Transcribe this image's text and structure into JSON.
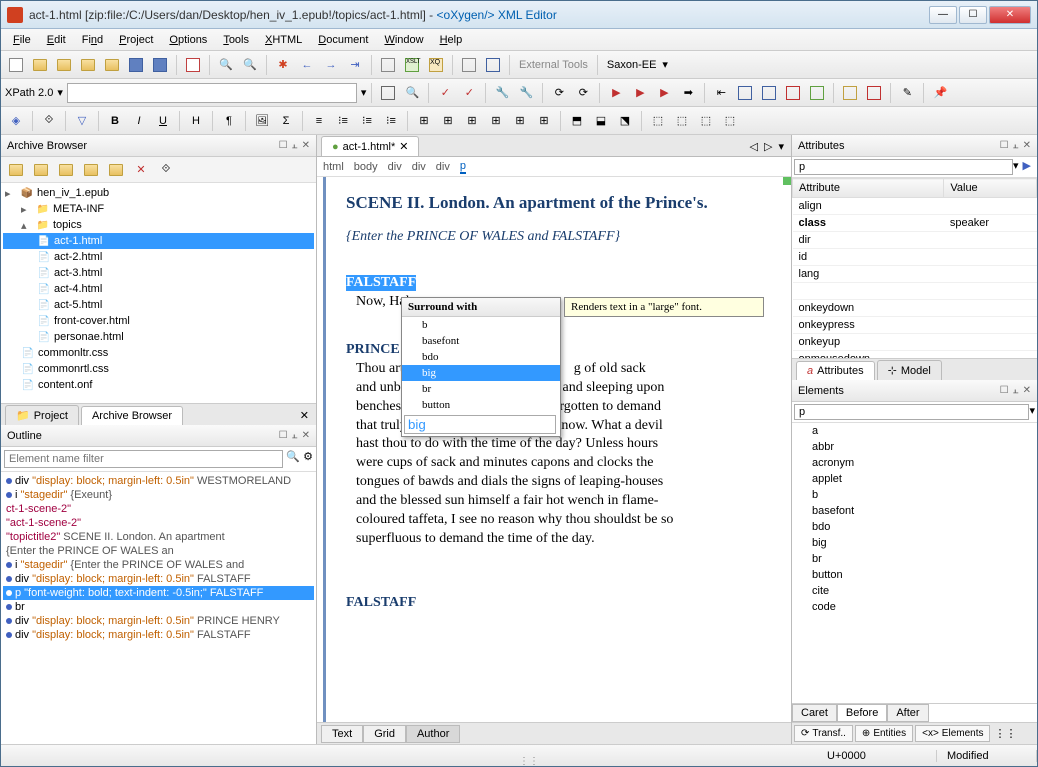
{
  "titlebar": {
    "text_prefix": "act-1.html [zip:file:/C:/Users/dan/Desktop/hen_iv_1.epub!/topics/act-1.html] - ",
    "app_name": "<oXygen/> XML Editor"
  },
  "menubar": [
    "File",
    "Edit",
    "Find",
    "Project",
    "Options",
    "Tools",
    "XHTML",
    "Document",
    "Window",
    "Help"
  ],
  "toolbar2": {
    "xpath_label": "XPath 2.0",
    "saxon_label": "Saxon-EE",
    "ext_tools": "External Tools"
  },
  "archive_browser": {
    "title": "Archive Browser",
    "root": "hen_iv_1.epub",
    "meta_inf": "META-INF",
    "topics": "topics",
    "files": [
      "act-1.html",
      "act-2.html",
      "act-3.html",
      "act-4.html",
      "act-5.html",
      "front-cover.html",
      "personae.html"
    ],
    "css_files": [
      "commonltr.css",
      "commonrtl.css"
    ],
    "last": "content.onf"
  },
  "left_tabs": {
    "project": "Project",
    "archive": "Archive Browser"
  },
  "outline": {
    "title": "Outline",
    "placeholder": "Element name filter",
    "items": [
      {
        "el": "div",
        "style": "\"display: block; margin-left: 0.5in\"",
        "text": "WESTMORELAND"
      },
      {
        "el": "i",
        "style": "\"stagedir\"",
        "text": "{Exeunt}"
      },
      {
        "el": "",
        "style": "",
        "text": "ct-1-scene-2\"",
        "quoted": true
      },
      {
        "el": "",
        "style": "",
        "text": "\"act-1-scene-2\"",
        "quoted": true
      },
      {
        "el": "",
        "style": "\"topictitle2\"",
        "text": "SCENE II. London. An apartment",
        "quoted": true
      },
      {
        "el": "",
        "style": "",
        "text": "{Enter the PRINCE OF WALES an"
      },
      {
        "el": "i",
        "style": "\"stagedir\"",
        "text": "{Enter the PRINCE OF WALES and"
      },
      {
        "el": "div",
        "style": "\"display: block; margin-left: 0.5in\"",
        "text": "FALSTAFF"
      },
      {
        "el": "p",
        "style": "\"font-weight: bold; text-indent: -0.5in;\"",
        "text": "FALSTAFF",
        "selected": true
      },
      {
        "el": "br",
        "style": "",
        "text": ""
      },
      {
        "el": "div",
        "style": "\"display: block; margin-left: 0.5in\"",
        "text": "PRINCE HENRY"
      },
      {
        "el": "div",
        "style": "\"display: block; margin-left: 0.5in\"",
        "text": "FALSTAFF"
      }
    ]
  },
  "editor": {
    "tab": "act-1.html*",
    "breadcrumb": [
      "html",
      "body",
      "div",
      "div",
      "div",
      "p"
    ],
    "scene_title": "SCENE II. London. An apartment of the Prince's.",
    "stage_dir": "{Enter the PRINCE OF WALES and FALSTAFF}",
    "speaker1": "FALSTAFF",
    "line1": "Now, Hal, v",
    "speaker2": "PRINCE HE",
    "speech2": "Thou art so fat-witted, with drinking of old sack and unbuttoning thee after supper and sleeping upon benches after noon, that thou hast forgotten to demand that truly which thou wouldst truly know. What a devil hast thou to do with the time of the day? Unless hours were cups of sack and minutes capons and clocks the tongues of bawds and dials the signs of leaping-houses and the blessed sun himself a fair hot wench in flame-coloured taffeta, I see no reason why thou shouldst be so superfluous to demand the time of the day.",
    "speech2_p1": "Thou art so",
    "speech2_p2": "g of old sack",
    "speech2_p3": "and unbutto",
    "speech2_p4": "and sleeping upon",
    "speaker3": "FALSTAFF",
    "view_tabs": [
      "Text",
      "Grid",
      "Author"
    ]
  },
  "popup": {
    "header": "Surround with",
    "items": [
      "b",
      "basefont",
      "bdo",
      "big",
      "br",
      "button"
    ],
    "selected": "big",
    "input_value": "big",
    "tooltip": "Renders text in a \"large\" font."
  },
  "attributes": {
    "title": "Attributes",
    "element": "p",
    "cols": [
      "Attribute",
      "Value"
    ],
    "rows": [
      {
        "name": "align",
        "value": ""
      },
      {
        "name": "class",
        "value": "speaker",
        "bold": true
      },
      {
        "name": "dir",
        "value": ""
      },
      {
        "name": "id",
        "value": ""
      },
      {
        "name": "lang",
        "value": ""
      },
      {
        "name": "onkeydown",
        "value": ""
      },
      {
        "name": "onkeypress",
        "value": ""
      },
      {
        "name": "onkeyup",
        "value": ""
      },
      {
        "name": "onmousedown",
        "value": ""
      }
    ],
    "tabs": [
      "Attributes",
      "Model"
    ]
  },
  "elements": {
    "title": "Elements",
    "element": "p",
    "items": [
      "a",
      "abbr",
      "acronym",
      "applet",
      "b",
      "basefont",
      "bdo",
      "big",
      "br",
      "button",
      "cite",
      "code"
    ],
    "caret_tabs": [
      "Caret",
      "Before",
      "After"
    ]
  },
  "bottom_tabs": [
    "Transf..",
    "Entities",
    "Elements"
  ],
  "statusbar": {
    "unicode": "U+0000",
    "modified": "Modified"
  }
}
